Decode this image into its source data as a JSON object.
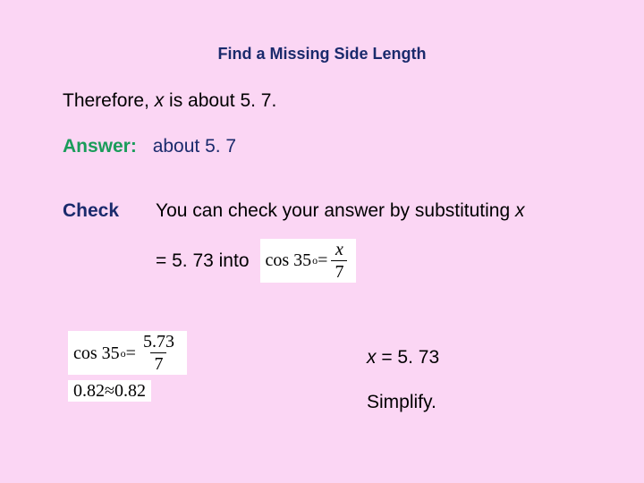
{
  "title": "Find a Missing Side Length",
  "therefore": {
    "pre": "Therefore, ",
    "var": "x",
    "post": " is about 5. 7."
  },
  "answer": {
    "label": "Answer:",
    "value": "about 5. 7"
  },
  "check": {
    "label": "Check",
    "text_pre": "You can check your answer by substituting ",
    "text_var": "x",
    "eq_line": "= 5. 73 into"
  },
  "inline_formula": {
    "lhs": "cos 35",
    "deg": "o",
    "mid": " = ",
    "num_var": "x",
    "den": "7"
  },
  "left_formulas": {
    "f1": {
      "lhs": "cos 35",
      "deg": "o",
      "mid": " = ",
      "num": "5.73",
      "den": "7"
    },
    "f2": {
      "lhs": "0.82",
      "approx": " ≈ ",
      "rhs": "0.82"
    }
  },
  "right": {
    "r1_var": "x",
    "r1_rest": " = 5. 73",
    "r2": "Simplify."
  }
}
